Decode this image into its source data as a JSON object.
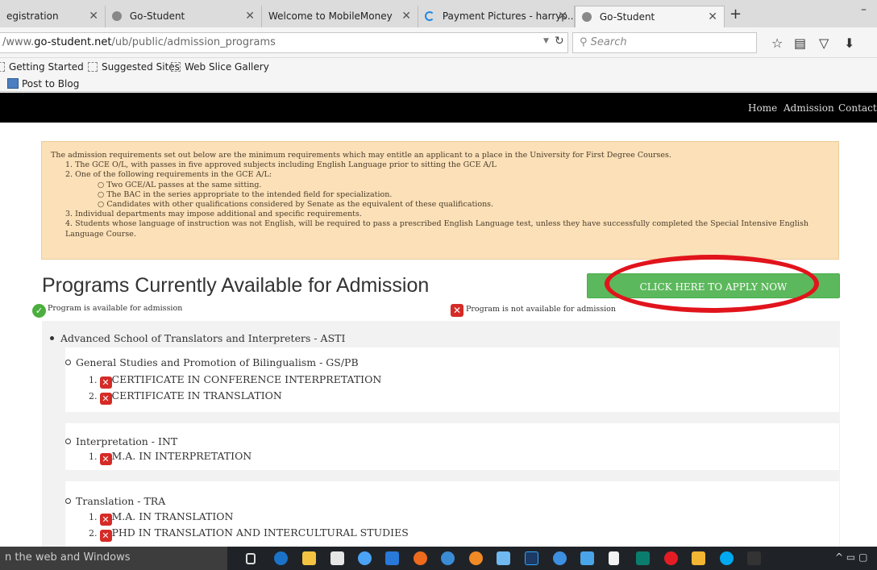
{
  "browser": {
    "tabs": [
      {
        "label": "egistration",
        "active": false,
        "favicon_color": ""
      },
      {
        "label": "Go-Student",
        "active": false,
        "favicon_color": "#555555"
      },
      {
        "label": "Welcome to MobileMoney",
        "active": false,
        "favicon_color": ""
      },
      {
        "label": "Payment Pictures - harryp...",
        "active": false,
        "favicon_color": "#1e88e5"
      },
      {
        "label": "Go-Student",
        "active": true,
        "favicon_color": "#555555"
      }
    ],
    "url_prefix": "/www.",
    "url_host": "go-student.net",
    "url_path": "/ub/public/admission_programs",
    "search_placeholder": "Search",
    "bookmarks": [
      "Getting Started",
      "Suggested Sites",
      "Web Slice Gallery"
    ],
    "post_to_blog": "Post to Blog"
  },
  "site": {
    "nav": [
      "Home",
      "Admission",
      "Contact"
    ]
  },
  "notice": {
    "intro": "The admission requirements set out below are the minimum requirements which may entitle an applicant to a place in the University for First Degree Courses.",
    "items": [
      "1. The GCE O/L, with passes in five approved subjects including English Language prior to sitting the GCE A/L",
      "2. One of the following requirements in the GCE A/L:",
      "3. Individual departments may impose additional and specific requirements.",
      "4. Students whose language of instruction was not English, will be required to pass a prescribed English Language test, unless they have successfully completed the Special Intensive English Language Course."
    ],
    "subitems": [
      "Two GCE/AL passes at the same sitting.",
      "The BAC in the series appropriate to the intended field for specialization.",
      "Candidates with other qualifications considered by Senate as the equivalent of these qualifications."
    ]
  },
  "programs": {
    "title": "Programs Currently Available for Admission",
    "apply_label": "CLICK HERE TO APPLY NOW",
    "annotation_number": "2",
    "annotation_color": "#e1141c",
    "legend_available": "Program is available for admission",
    "legend_unavailable": "Program is not available for admission",
    "school": "Advanced School of Translators and Interpreters - ASTI",
    "departments": [
      {
        "name": "General Studies and Promotion of Bilingualism - GS/PB",
        "programs": [
          "CERTIFICATE IN CONFERENCE INTERPRETATION",
          "CERTIFICATE IN TRANSLATION"
        ]
      },
      {
        "name": "Interpretation - INT",
        "programs": [
          "M.A. IN INTERPRETATION"
        ]
      },
      {
        "name": "Translation - TRA",
        "programs": [
          "M.A. IN TRANSLATION",
          "PHD IN TRANSLATION AND INTERCULTURAL STUDIES"
        ]
      }
    ]
  },
  "taskbar": {
    "search_text": "n the web and Windows"
  }
}
